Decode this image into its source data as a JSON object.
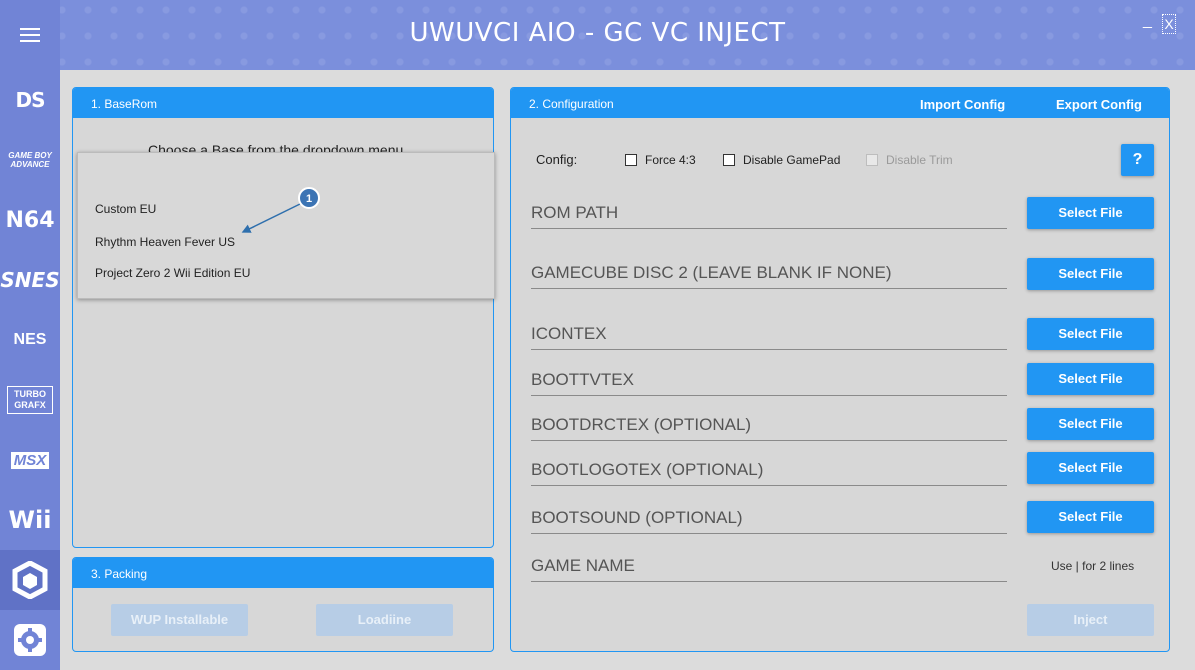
{
  "window": {
    "title": "UWUVCI AIO - GC VC INJECT",
    "minimize_label": "_",
    "close_label": "X"
  },
  "sidebar": {
    "menu_icon": "hamburger-icon",
    "items": [
      {
        "label": "DS",
        "icon": "nintendo-ds-logo"
      },
      {
        "label": "GAME BOY ADVANCE",
        "icon": "gba-logo"
      },
      {
        "label": "N64",
        "icon": "n64-logo"
      },
      {
        "label": "SNES",
        "icon": "snes-logo"
      },
      {
        "label": "NES",
        "icon": "nes-logo"
      },
      {
        "label": "TURBO GRAFX",
        "icon": "turbografx-logo"
      },
      {
        "label": "MSX",
        "icon": "msx-logo"
      },
      {
        "label": "Wii",
        "icon": "wii-logo"
      },
      {
        "label": "",
        "icon": "gamecube-logo",
        "active": true
      },
      {
        "label": "",
        "icon": "gear-icon"
      }
    ]
  },
  "baserom": {
    "header": "1. BaseRom",
    "prompt": "Choose a Base from the dropdown menu",
    "options": [
      "Custom EU",
      "Rhythm Heaven Fever US",
      "Project Zero 2 Wii Edition EU"
    ]
  },
  "packing": {
    "header": "3. Packing",
    "wup_label": "WUP Installable",
    "loadiine_label": "Loadiine"
  },
  "configuration": {
    "header": "2. Configuration",
    "import_label": "Import Config",
    "export_label": "Export Config",
    "config_label": "Config:",
    "checkboxes": [
      {
        "label": "Force 4:3",
        "checked": false,
        "enabled": true
      },
      {
        "label": "Disable GamePad",
        "checked": false,
        "enabled": true
      },
      {
        "label": "Disable Trim",
        "checked": false,
        "enabled": false
      }
    ],
    "help_label": "?",
    "fields": [
      "ROM PATH",
      "GAMECUBE DISC 2 (LEAVE BLANK IF NONE)",
      "ICONTEX",
      "BOOTTVTEX",
      "BOOTDRCTEX (OPTIONAL)",
      "BOOTLOGOTEX (OPTIONAL)",
      "BOOTSOUND (OPTIONAL)",
      "GAME NAME"
    ],
    "select_label": "Select File",
    "hint": "Use | for 2 lines",
    "inject_label": "Inject"
  },
  "annotation": {
    "number": "1"
  },
  "colors": {
    "accent": "#2196f3",
    "sidebar": "#7184d6",
    "header": "#7b8fdc",
    "background": "#dcdcdc",
    "disabled_button": "#b7cde6",
    "annotation": "#2e6fad"
  }
}
